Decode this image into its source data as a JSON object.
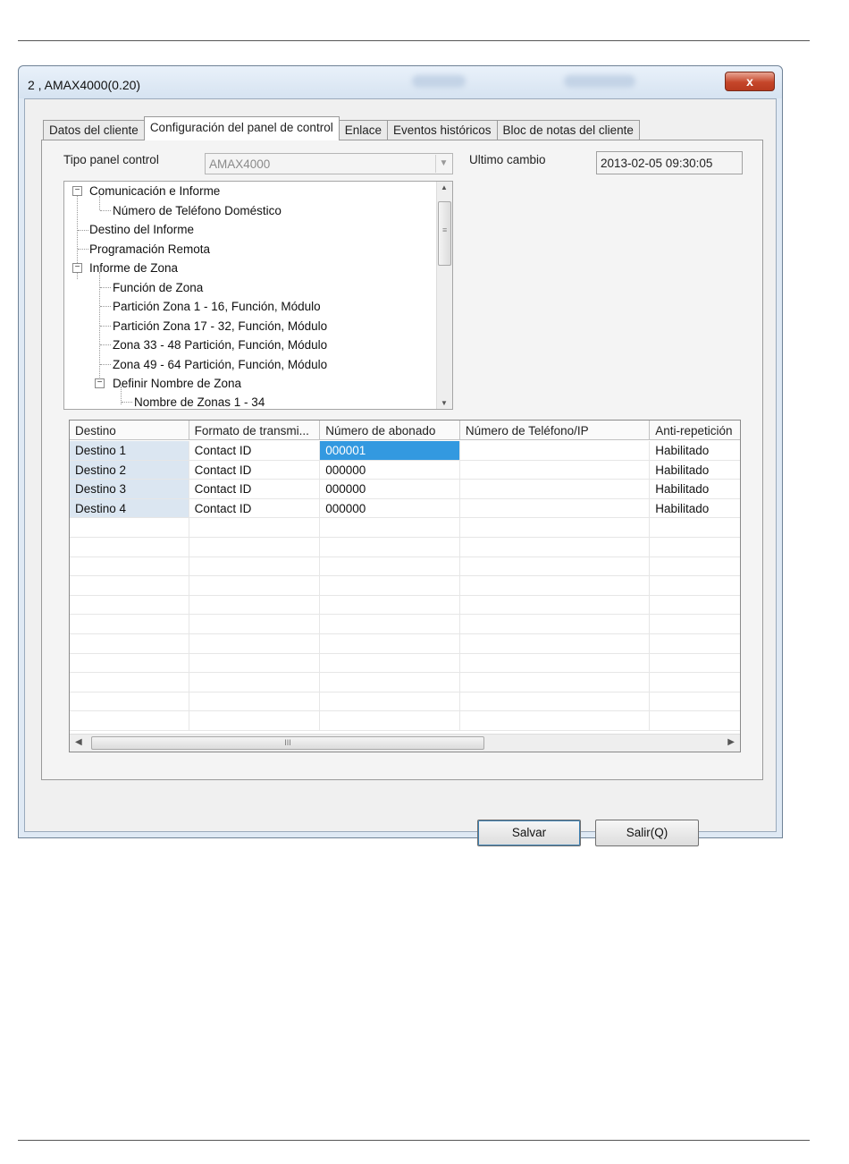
{
  "window": {
    "title": "2 , AMAX4000(0.20)",
    "close_label": "x"
  },
  "tabs": [
    {
      "label": "Datos del cliente"
    },
    {
      "label": "Configuración del panel de control"
    },
    {
      "label": "Enlace"
    },
    {
      "label": "Eventos históricos"
    },
    {
      "label": "Bloc de notas del cliente"
    }
  ],
  "active_tab": "Configuración del panel de control",
  "panel": {
    "type_label": "Tipo panel control",
    "type_value": "AMAX4000",
    "last_change_label": "Ultimo cambio",
    "last_change_value": "2013-02-05 09:30:05"
  },
  "tree": {
    "items": [
      {
        "label": "Comunicación e Informe",
        "level": 0,
        "expander": "−"
      },
      {
        "label": "Número de Teléfono Doméstico",
        "level": 1
      },
      {
        "label": "Destino del Informe",
        "level": 0
      },
      {
        "label": "Programación Remota",
        "level": 0
      },
      {
        "label": "Informe de Zona",
        "level": 0,
        "expander": "−"
      },
      {
        "label": "Función de Zona",
        "level": 1
      },
      {
        "label": "Partición Zona 1 - 16, Función, Módulo",
        "level": 1
      },
      {
        "label": "Partición Zona 17 - 32, Función, Módulo",
        "level": 1
      },
      {
        "label": "Zona 33 - 48 Partición, Función, Módulo",
        "level": 1
      },
      {
        "label": "Zona 49 - 64 Partición, Función, Módulo",
        "level": 1
      },
      {
        "label": "Definir Nombre de Zona",
        "level": 1,
        "expander": "−"
      },
      {
        "label": "Nombre de Zonas 1 - 34",
        "level": 2
      }
    ]
  },
  "grid": {
    "columns": [
      "Destino",
      "Formato de transmi...",
      "Número de abonado",
      "Número de Teléfono/IP",
      "Anti-repetición"
    ],
    "rows": [
      [
        "Destino 1",
        "Contact ID",
        "000001",
        "",
        "Habilitado"
      ],
      [
        "Destino 2",
        "Contact ID",
        "000000",
        "",
        "Habilitado"
      ],
      [
        "Destino 3",
        "Contact ID",
        "000000",
        "",
        "Habilitado"
      ],
      [
        "Destino 4",
        "Contact ID",
        "000000",
        "",
        "Habilitado"
      ]
    ],
    "empty_rows": 11,
    "hscroll_grip": "III"
  },
  "buttons": {
    "save": "Salvar",
    "exit": "Salir(Q)"
  },
  "colors": {
    "selection": "#3399e0",
    "first_column": "#dbe6f1",
    "close_button": "#c5462a"
  }
}
